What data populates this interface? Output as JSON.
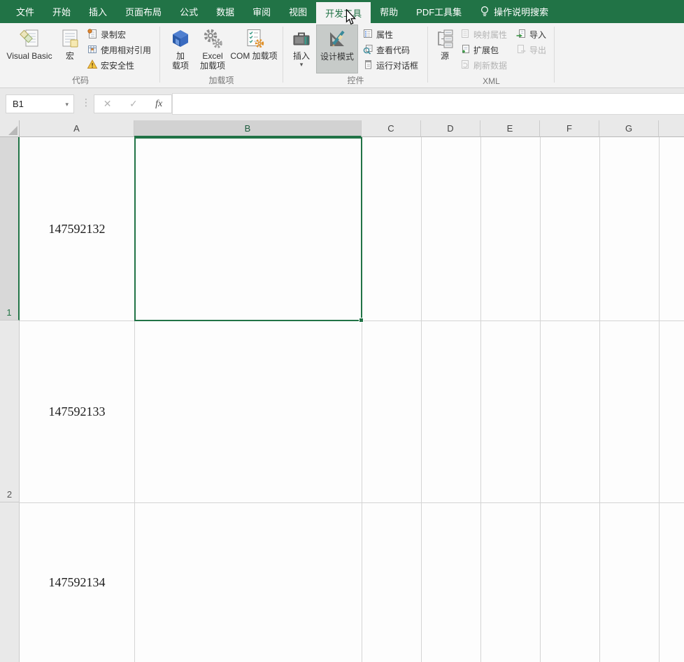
{
  "tabs": [
    {
      "label": "文件"
    },
    {
      "label": "开始"
    },
    {
      "label": "插入"
    },
    {
      "label": "页面布局"
    },
    {
      "label": "公式"
    },
    {
      "label": "数据"
    },
    {
      "label": "审阅"
    },
    {
      "label": "视图"
    },
    {
      "label": "开发工具",
      "active": true
    },
    {
      "label": "帮助"
    },
    {
      "label": "PDF工具集"
    },
    {
      "label": "操作说明搜索",
      "icon": "lightbulb"
    }
  ],
  "ribbon": {
    "code_group": {
      "label": "代码",
      "visual_basic": "Visual Basic",
      "macros": "宏",
      "record_macro": "录制宏",
      "relative_refs": "使用相对引用",
      "macro_security": "宏安全性"
    },
    "addins_group": {
      "label": "加载项",
      "addins_line1": "加",
      "addins_line2": "载项",
      "excel_addins_line1": "Excel",
      "excel_addins_line2": "加载项",
      "com_addins": "COM 加载项"
    },
    "controls_group": {
      "label": "控件",
      "insert": "插入",
      "design_mode": "设计模式",
      "design_mode_active": true,
      "properties": "属性",
      "view_code": "查看代码",
      "run_dialog": "运行对话框"
    },
    "xml_group": {
      "label": "XML",
      "source": "源",
      "map_properties": "映射属性",
      "expansion_packs": "扩展包",
      "refresh_data": "刷新数据",
      "import": "导入",
      "export": "导出"
    }
  },
  "formula_bar": {
    "name_box": "B1",
    "dropdown_glyph": "▾",
    "dots_glyph": "⋮",
    "cancel_glyph": "✕",
    "enter_glyph": "✓",
    "fx_glyph": "fx",
    "formula_value": ""
  },
  "sheet": {
    "selected_cell": "B1",
    "selected_column": "B",
    "selected_row": "1",
    "column_headers": [
      "A",
      "B",
      "C",
      "D",
      "E",
      "F",
      "G"
    ],
    "row_headers": [
      "1",
      "2"
    ],
    "cells": [
      {
        "ref": "A1",
        "value": "147592132"
      },
      {
        "ref": "A2",
        "value": "147592133"
      },
      {
        "ref": "A3",
        "value": "147592134"
      }
    ]
  },
  "colors": {
    "accent_green": "#217346",
    "ribbon_bg": "#f3f3f3",
    "design_mode_active_bg": "#c7cbc9",
    "gridline": "#d4d4d4"
  }
}
